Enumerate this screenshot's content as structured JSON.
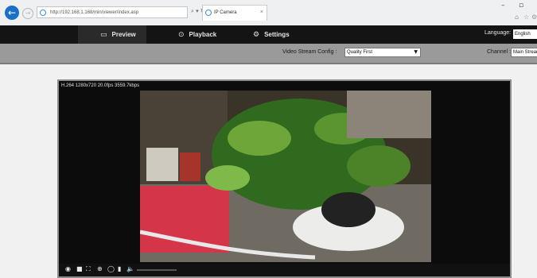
{
  "browser": {
    "url": "http://192.168.1.168/min/viewer/index.asp",
    "address_controls": "⌕ ▾ ↻",
    "tab_title": "IP Camera",
    "close_tab": "×",
    "min_glyph": "–",
    "max_glyph": "▫"
  },
  "nav": {
    "items": [
      {
        "label": "Preview",
        "icon": "monitor-icon",
        "glyph": "▭"
      },
      {
        "label": "Playback",
        "icon": "playback-icon",
        "glyph": "⊙"
      },
      {
        "label": "Settings",
        "icon": "settings-icon",
        "glyph": "⚙"
      }
    ],
    "active": "Preview",
    "language_label": "Language:",
    "language_value": "English"
  },
  "subbar": {
    "video_stream_label": "Video Stream Config :",
    "video_stream_value": "Quality First",
    "channel_label": "Channel :",
    "channel_value": "Main Stream"
  },
  "player": {
    "info": "H.264 1280x720 20.0fps 3559.7kbps",
    "controls": [
      {
        "name": "record-icon",
        "glyph": "◉"
      },
      {
        "name": "snapshot-icon",
        "glyph": "■"
      },
      {
        "name": "fullscreen-icon",
        "glyph": "⛶"
      },
      {
        "name": "zoom-icon",
        "glyph": "⊕"
      },
      {
        "name": "audio-talk-icon",
        "glyph": "◯"
      },
      {
        "name": "mic-icon",
        "glyph": "▮"
      },
      {
        "name": "speaker-icon",
        "glyph": "🔈"
      }
    ],
    "volume": 0.0
  },
  "colors": {
    "nav_bg": "#141414",
    "subbar_bg": "#9a9a9a",
    "accent_blue": "#1b6fc9"
  }
}
